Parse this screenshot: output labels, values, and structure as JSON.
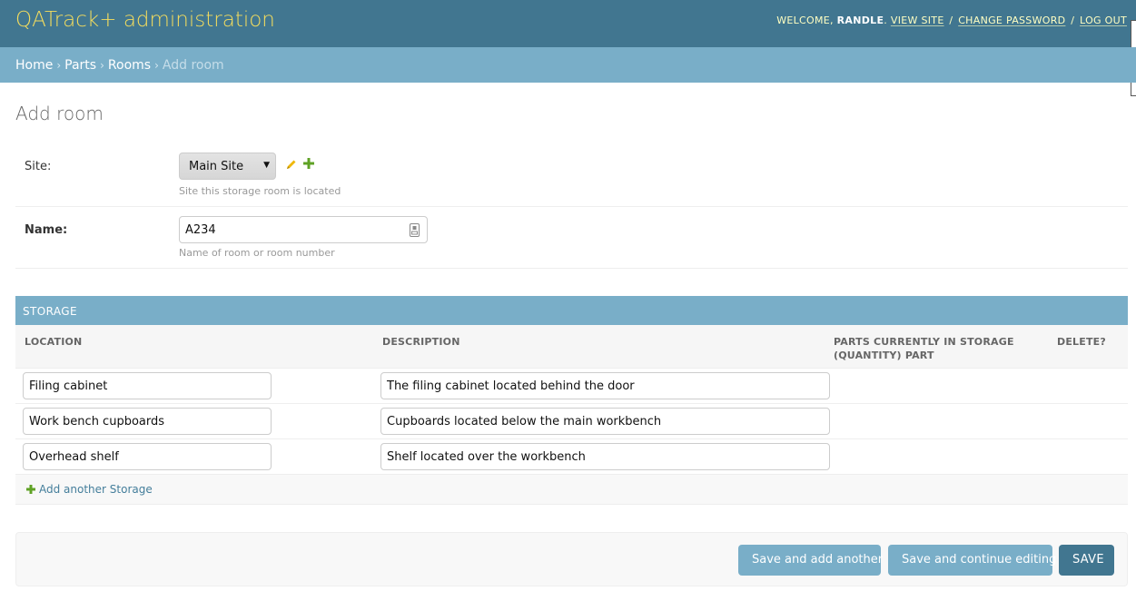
{
  "header": {
    "brand": "QATrack+ administration",
    "welcome_prefix": "WELCOME, ",
    "username": "RANDLE",
    "welcome_suffix": ".",
    "view_site": "VIEW SITE",
    "change_password": "CHANGE PASSWORD",
    "log_out": "LOG OUT",
    "sep": "/"
  },
  "breadcrumbs": {
    "items": [
      "Home",
      "Parts",
      "Rooms"
    ],
    "sep": "›",
    "current": "Add room"
  },
  "page": {
    "title": "Add room"
  },
  "form": {
    "site": {
      "label": "Site:",
      "selected": "Main Site",
      "help": "Site this storage room is located"
    },
    "name": {
      "label": "Name:",
      "value": "A234",
      "help": "Name of room or room number"
    }
  },
  "storage": {
    "title": "STORAGE",
    "columns": {
      "location": "LOCATION",
      "description": "DESCRIPTION",
      "parts": "PARTS CURRENTLY IN STORAGE (QUANTITY) PART",
      "delete": "DELETE?"
    },
    "rows": [
      {
        "location": "Filing cabinet",
        "description": "The filing cabinet located behind the door"
      },
      {
        "location": "Work bench cupboards",
        "description": "Cupboards located below the main workbench"
      },
      {
        "location": "Overhead shelf",
        "description": "Shelf located over the workbench"
      }
    ],
    "add_label": "Add another Storage"
  },
  "submit": {
    "save_add": "Save and add another",
    "save_continue": "Save and continue editing",
    "save": "SAVE"
  },
  "colors": {
    "header_bg": "#417690",
    "brand": "#f5dd5d",
    "breadcrumb_bg": "#79aec8",
    "button_secondary": "#79aec8",
    "button_primary": "#417690",
    "add_green": "#5fa225"
  },
  "icons": {
    "edit": "pencil-icon",
    "add": "plus-icon",
    "input_helper": "keyboard-icon"
  }
}
